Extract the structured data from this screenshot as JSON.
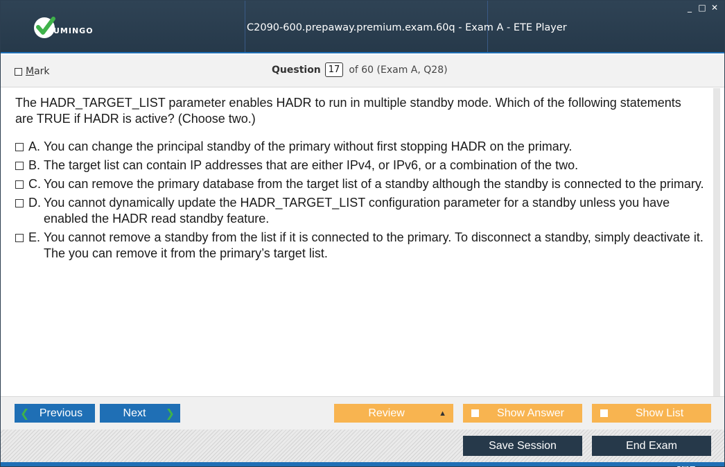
{
  "window": {
    "title": "C2090-600.prepaway.premium.exam.60q - Exam A - ETE Player",
    "logo_text": "UMINGO",
    "controls": {
      "minimize": "_",
      "maximize": "□",
      "close": "✕"
    }
  },
  "question_bar": {
    "mark_label": "Mark",
    "question_word": "Question",
    "question_number": "17",
    "of_text": "of 60 (Exam A, Q28)"
  },
  "question": {
    "text": "The HADR_TARGET_LIST parameter enables HADR to run in multiple standby mode. Which of the following statements are TRUE if HADR is active? (Choose two.)",
    "options": [
      {
        "letter": "A.",
        "text": "You can change the principal standby of the primary without first stopping HADR on the primary."
      },
      {
        "letter": "B.",
        "text": "The target list can contain IP addresses that are either IPv4, or IPv6, or a combination of the two."
      },
      {
        "letter": "C.",
        "text": "You can remove the primary database from the target list of a standby although the standby is connected to the primary."
      },
      {
        "letter": "D.",
        "text": "You cannot dynamically update the HADR_TARGET_LIST configuration parameter for a standby unless you have enabled the HADR read standby feature."
      },
      {
        "letter": "E.",
        "text": "You cannot remove a standby from the list if it is connected to the primary. To disconnect a standby, simply deactivate it. The you can remove it from the primary’s target list."
      }
    ]
  },
  "zoom": {
    "icons": [
      "search-icon",
      "zoom-in-icon",
      "zoom-out-icon"
    ]
  },
  "nav": {
    "previous_label": "Previous",
    "next_label": "Next",
    "review_label": "Review",
    "show_answer_label": "Show Answer",
    "show_list_label": "Show List"
  },
  "footer": {
    "save_session_label": "Save Session",
    "end_exam_label": "End Exam"
  },
  "colors": {
    "titlebar": "#2f4355",
    "accent_blue": "#1f6fb5",
    "orange": "#f8b450",
    "dark_button": "#26394a",
    "logo_green": "#3fb24a"
  }
}
